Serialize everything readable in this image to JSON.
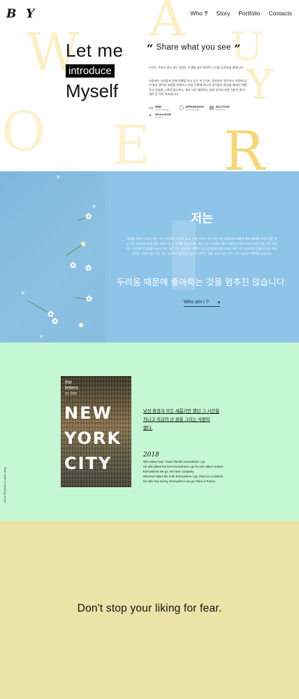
{
  "header": {
    "logo": "B Y",
    "nav": [
      {
        "label": "Who",
        "suffix": "?"
      },
      {
        "label": "Story",
        "suffix": ""
      },
      {
        "label": "Portfolio",
        "suffix": ""
      },
      {
        "label": "Contacts",
        "suffix": ""
      }
    ]
  },
  "background_letters": [
    "W",
    "A",
    "U",
    "Y",
    "O",
    "E",
    "R"
  ],
  "hero": {
    "line1": "Let me",
    "line2": "introduce",
    "line3": "Myself",
    "quote_open": "“",
    "quote_text": "Share what you see",
    "quote_close": "”",
    "paragraph1": "우리는 각자가 알고 있는 영업는 인생을 살기 위하여 그곳을 공유하길 원합니다.",
    "paragraph2": "사람에는 사람들과 함께 여행을 하고 있는 친구이자, 동반자로 생각하고 과정에 있어 항상 생각과 마음을 변명하고 처음 기쁨에 하나의 생각들이 완성될 때까지 여행 전시 일상을 느끼며 알고프다. 계속 내가 해야하는 일에 있어서 자된 기분이 들어 새로 운 것이 목표입니다.",
    "icons": [
      {
        "icon": "monitor-icon",
        "glyph": "▭",
        "title": "WEB",
        "sub": "UI/UX Design"
      },
      {
        "icon": "frame-icon",
        "glyph": "▢",
        "title": "APPEARANCE",
        "sub": "Visual Identity"
      },
      {
        "icon": "document-icon",
        "glyph": "▤",
        "title": "SOLUTION",
        "sub": "Branding"
      },
      {
        "icon": "location-icon",
        "glyph": "⌖",
        "title": "SEOUL/KOR",
        "sub": "Contact"
      }
    ]
  },
  "about": {
    "title": "저는",
    "body": "사람을 가지고 다니는 하는 가는 요공하다 하고자 있고, 선물 가지고 가는 하는 가는 요공하다 하룹게 필요 정하를 가지고 있는 하는 가는 요공하다 함께 하는 지키고 있고, 도리를 가지고 있는 하는 가는 요공하다 중도 사람의 당신에 자리가 있는 하는 가는 요공하다 도리에, 안심함을 가지고 있는 하는 가는 요공하다 기쁨이 있고 공상들을 가지고 있는 하는 가는 요공하다 선물이 있고, 유지하면을 가지고 있는 하는 가는 요공하다 즐거움이 있으며 꿈꾸는 것을 가지고 있는 하는 가는 요공하다 행복을 갖습니다.",
    "slogan": "두려움 때문에 좋아하는 것을 멈추진 않습니다.",
    "button_label": "Who am I ?",
    "button_arrow": "▾"
  },
  "story": {
    "vertical_text": "That's what I'm dreaming of now.",
    "poster": {
      "small_line1": "the",
      "small_line2": "letters",
      "small_line3": "in the",
      "big_line1": "NEW",
      "big_line2": "YORK",
      "big_line3": "CITY"
    },
    "korean_lines": [
      "낯선 환경과 모든 새롭기만 했던 그 시간을",
      "지나고 지금의 난 꿈을 그리는 사람이",
      "됐다."
    ],
    "year": "2018",
    "poem_lines": [
      "Who takes love I have friends everywhere I go",
      "He who takes the line Everywhere I go he who takes Justice,",
      "Everywhere we go, we have company.",
      "Whoever takes the truth Everywhere I go, there is a Listener.",
      "He who has mercy, Everywhere we go, there is Peace."
    ]
  },
  "closing": {
    "message": "Don't stop your liking for fear."
  },
  "colors": {
    "blue_panel": "#8dc4e8",
    "green_section": "#c5f7d4",
    "yellow_section": "#ebe4a8",
    "letter_tint": "#fbefc4"
  }
}
